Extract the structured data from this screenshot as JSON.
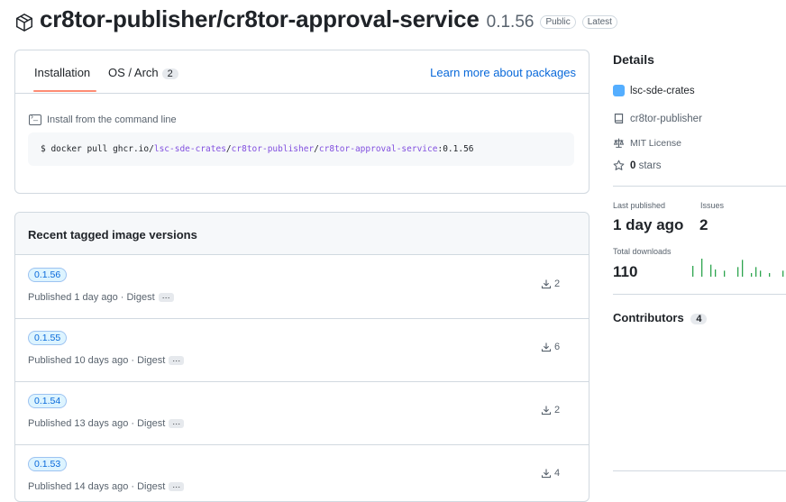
{
  "header": {
    "icon": "package-icon",
    "title": "cr8tor-publisher/cr8tor-approval-service",
    "version": "0.1.56",
    "badges": [
      "Public",
      "Latest"
    ]
  },
  "install": {
    "tabs": [
      {
        "label": "Installation",
        "active": true
      },
      {
        "label": "OS / Arch",
        "count": "2"
      }
    ],
    "learn_more": "Learn more about packages",
    "command_label": "Install from the command line",
    "command_prefix": "$ docker pull ghcr.io/",
    "command_org": "lsc-sde-crates",
    "command_sep1": "/",
    "command_owner": "cr8tor-publisher",
    "command_sep2": "/",
    "command_pkg": "cr8tor-approval-service",
    "command_tag": ":0.1.56"
  },
  "versions": {
    "heading": "Recent tagged image versions",
    "rows": [
      {
        "tag": "0.1.56",
        "published": "Published 1 day ago · Digest",
        "digest_more": "···",
        "downloads": "2"
      },
      {
        "tag": "0.1.55",
        "published": "Published 10 days ago · Digest",
        "digest_more": "···",
        "downloads": "6"
      },
      {
        "tag": "0.1.54",
        "published": "Published 13 days ago · Digest",
        "digest_more": "···",
        "downloads": "2"
      },
      {
        "tag": "0.1.53",
        "published": "Published 14 days ago · Digest",
        "digest_more": "···",
        "downloads": "4"
      }
    ]
  },
  "sidebar": {
    "details_title": "Details",
    "org": "lsc-sde-crates",
    "repo": "cr8tor-publisher",
    "license": "MIT License",
    "stars_count": "0",
    "stars_label": " stars",
    "last_published_label": "Last published",
    "last_published_value": "1 day ago",
    "issues_label": "Issues",
    "issues_value": "2",
    "total_downloads_label": "Total downloads",
    "total_downloads_value": "110",
    "download_spark": [
      9,
      0,
      15,
      0,
      10,
      6,
      0,
      5,
      0,
      0,
      8,
      14,
      0,
      3,
      8,
      5,
      0,
      3,
      0,
      0,
      5
    ],
    "contributors_label": "Contributors",
    "contributors_count": "4"
  },
  "colors": {
    "accent": "#0969da",
    "tab_underline": "#fd8c73",
    "spark": "#2da44e",
    "purple_link": "#8250df"
  }
}
